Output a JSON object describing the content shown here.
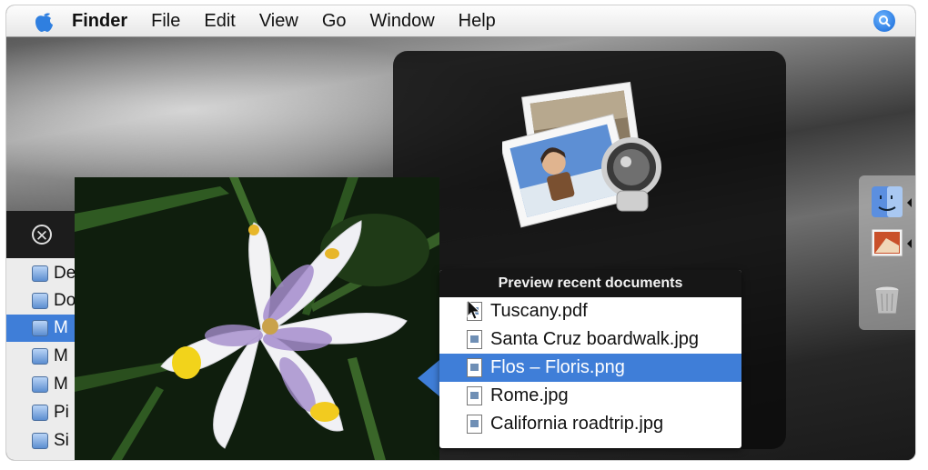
{
  "menubar": {
    "apple_icon": "apple-logo-icon",
    "app_name": "Finder",
    "items": [
      "File",
      "Edit",
      "View",
      "Go",
      "Window",
      "Help"
    ],
    "spotlight_icon": "spotlight-search-icon"
  },
  "finder_window": {
    "close_icon": "close-icon",
    "sidebar": [
      {
        "label": "De",
        "icon": "desktop-folder-icon",
        "selected": false
      },
      {
        "label": "Do",
        "icon": "documents-folder-icon",
        "selected": false
      },
      {
        "label": "M",
        "icon": "folder-icon",
        "selected": true
      },
      {
        "label": "M",
        "icon": "folder-icon",
        "selected": false
      },
      {
        "label": "M",
        "icon": "folder-icon",
        "selected": false
      },
      {
        "label": "Pi",
        "icon": "pictures-folder-icon",
        "selected": false
      },
      {
        "label": "Si",
        "icon": "sites-folder-icon",
        "selected": false
      }
    ]
  },
  "preview_app_icon": "preview-app-icon",
  "recent_documents": {
    "title": "Preview recent documents",
    "items": [
      {
        "name": "Tuscany.pdf",
        "selected": false
      },
      {
        "name": "Santa Cruz boardwalk.jpg",
        "selected": false
      },
      {
        "name": "Flos – Floris.png",
        "selected": true
      },
      {
        "name": "Rome.jpg",
        "selected": false
      },
      {
        "name": "California roadtrip.jpg",
        "selected": false
      }
    ]
  },
  "dock": {
    "items": [
      "finder-icon",
      "preview-icon",
      "trash-icon"
    ]
  },
  "colors": {
    "selection": "#3f7ed8",
    "hud": "#0c0c0c"
  }
}
